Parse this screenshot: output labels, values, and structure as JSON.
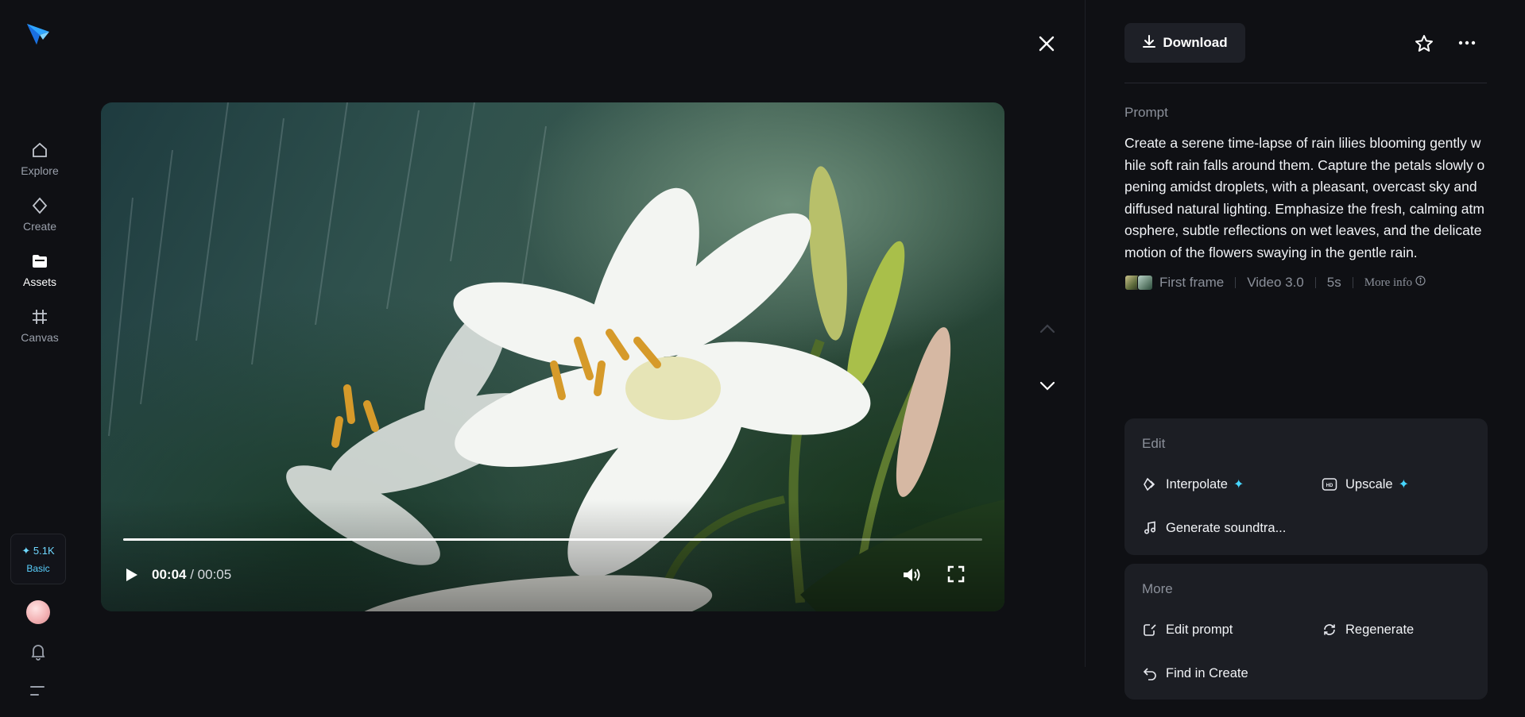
{
  "sidebar": {
    "items": [
      {
        "label": "Explore",
        "icon": "home-icon"
      },
      {
        "label": "Create",
        "icon": "diamond-icon"
      },
      {
        "label": "Assets",
        "icon": "folder-icon"
      },
      {
        "label": "Canvas",
        "icon": "canvas-icon"
      }
    ],
    "credits": {
      "amount": "✦ 5.1K",
      "plan": "Basic"
    }
  },
  "player": {
    "current_time": "00:04",
    "duration": "/ 00:05",
    "progress": 0.78
  },
  "toolbar": {
    "download_label": "Download"
  },
  "prompt": {
    "label": "Prompt",
    "text": "Create a serene time-lapse of rain lilies blooming gently while soft rain falls around them. Capture the petals slowly opening amidst droplets, with a pleasant, overcast sky and diffused natural lighting. Emphasize the fresh, calming atmosphere, subtle reflections on wet leaves, and the delicate motion of the flowers swaying in the gentle rain."
  },
  "meta": {
    "first_frame": "First frame",
    "model": "Video 3.0",
    "duration": "5s",
    "more_info": "More info"
  },
  "edit": {
    "title": "Edit",
    "interpolate": "Interpolate",
    "upscale": "Upscale",
    "soundtrack": "Generate soundtra..."
  },
  "more": {
    "title": "More",
    "edit_prompt": "Edit prompt",
    "regenerate": "Regenerate",
    "find_in_create": "Find in Create"
  },
  "colors": {
    "accent": "#47d6ff",
    "background": "#0f1014",
    "card": "#1c1e24"
  }
}
